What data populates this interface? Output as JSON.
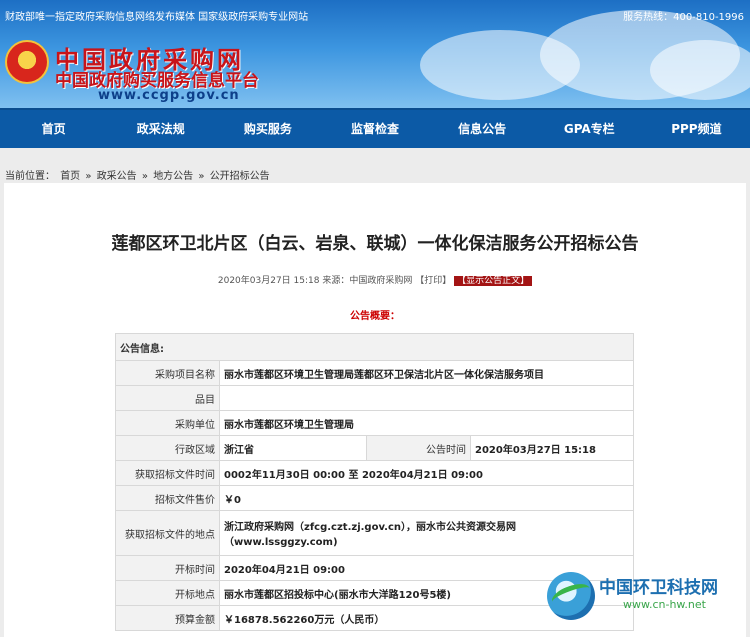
{
  "topbar": {
    "left": "财政部唯一指定政府采购信息网络发布媒体 国家级政府采购专业网站",
    "right": "服务热线：400-810-1996"
  },
  "brand": {
    "name": "中国政府采购网",
    "subtitle": "中国政府购买服务信息平台",
    "url": "www.ccgp.gov.cn"
  },
  "nav": [
    "首页",
    "政采法规",
    "购买服务",
    "监督检查",
    "信息公告",
    "GPA专栏",
    "PPP频道"
  ],
  "breadcrumb": {
    "prefix": "当前位置：",
    "items": [
      "首页",
      "政采公告",
      "地方公告",
      "公开招标公告"
    ],
    "sep": "»"
  },
  "notice": {
    "title": "莲都区环卫北片区（白云、岩泉、联城）一体化保洁服务公开招标公告",
    "meta": "2020年03月27日 15:18 来源：中国政府采购网",
    "print": "【打印】",
    "show_text": "【显示公告正文】",
    "summary": "公告概要："
  },
  "table": {
    "header": "公告信息:",
    "rows": [
      {
        "label": "采购项目名称",
        "value": "丽水市莲都区环境卫生管理局莲都区环卫保洁北片区一体化保洁服务项目"
      },
      {
        "label": "品目",
        "value": ""
      },
      {
        "label": "采购单位",
        "value": "丽水市莲都区环境卫生管理局"
      }
    ],
    "region_label": "行政区域",
    "region_value": "浙江省",
    "time_label": "公告时间",
    "time_value": "2020年03月27日 15:18",
    "rows2": [
      {
        "label": "获取招标文件时间",
        "value": "0002年11月30日 00:00 至 2020年04月21日 09:00"
      },
      {
        "label": "招标文件售价",
        "value": "￥0"
      },
      {
        "label": "获取招标文件的地点",
        "value": "浙江政府采购网（zfcg.czt.zj.gov.cn），丽水市公共资源交易网（www.lssggzy.com)"
      },
      {
        "label": "开标时间",
        "value": "2020年04月21日 09:00"
      },
      {
        "label": "开标地点",
        "value": "丽水市莲都区招投标中心(丽水市大洋路120号5楼)"
      },
      {
        "label": "预算金额",
        "value": "￥16878.562260万元（人民币）"
      }
    ]
  },
  "watermark": {
    "name": "中国环卫科技网",
    "url": "www.cn-hw.net"
  },
  "colors": {
    "nav": "#0c5aa6",
    "brand_red": "#c8141a",
    "summary_red": "#c00000",
    "show_button": "#a31414"
  }
}
